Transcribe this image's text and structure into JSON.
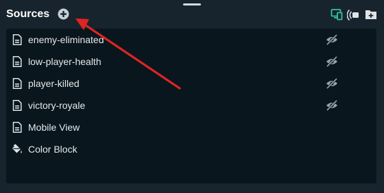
{
  "header": {
    "title": "Sources",
    "add_icon": "plus-circle-icon",
    "actions": [
      {
        "name": "selective-recording-icon",
        "color": "#31c3a2"
      },
      {
        "name": "studio-mode-icon",
        "color": "#dfe3e6"
      },
      {
        "name": "add-folder-icon",
        "color": "#dfe3e6"
      }
    ]
  },
  "sources": [
    {
      "label": "enemy-eliminated",
      "icon": "file-icon",
      "hidden": true
    },
    {
      "label": "low-player-health",
      "icon": "file-icon",
      "hidden": true
    },
    {
      "label": "player-killed",
      "icon": "file-icon",
      "hidden": true
    },
    {
      "label": "victory-royale",
      "icon": "file-icon",
      "hidden": true
    },
    {
      "label": "Mobile View",
      "icon": "file-icon",
      "hidden": false
    },
    {
      "label": "Color Block",
      "icon": "paint-bucket-icon",
      "hidden": false
    }
  ],
  "annotation": {
    "type": "arrow",
    "color": "#e02424",
    "points_to": "add-source-button"
  }
}
